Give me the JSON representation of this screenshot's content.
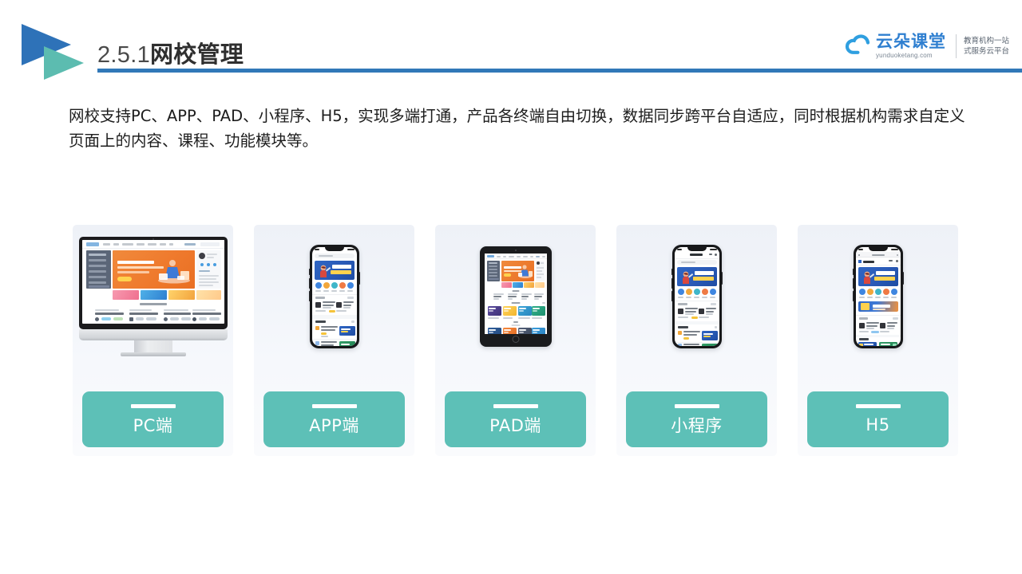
{
  "header": {
    "title_number": "2.5.1",
    "title_text": "网校管理",
    "logo_icon": "double-triangle-play-logo",
    "rule_color": "#3178b8",
    "logo_blue": "#2e72b8",
    "logo_teal": "#5cbcb0"
  },
  "brand": {
    "icon": "cloud-icon",
    "name_cn": "云朵课堂",
    "url": "yunduoketang.com",
    "tagline_line1": "教育机构一站",
    "tagline_line2": "式服务云平台",
    "color": "#2f7fd0"
  },
  "body": {
    "paragraph": "网校支持PC、APP、PAD、小程序、H5，实现多端打通，产品各终端自由切换，数据同步跨平台自适应，同时根据机构需求自定义页面上的内容、课程、功能模块等。"
  },
  "cards": {
    "accent_color": "#5dc0b7",
    "items": [
      {
        "label": "PC端",
        "device": "desktop-monitor"
      },
      {
        "label": "APP端",
        "device": "smartphone"
      },
      {
        "label": "PAD端",
        "device": "tablet"
      },
      {
        "label": "小程序",
        "device": "smartphone"
      },
      {
        "label": "H5",
        "device": "smartphone-browser"
      }
    ]
  }
}
